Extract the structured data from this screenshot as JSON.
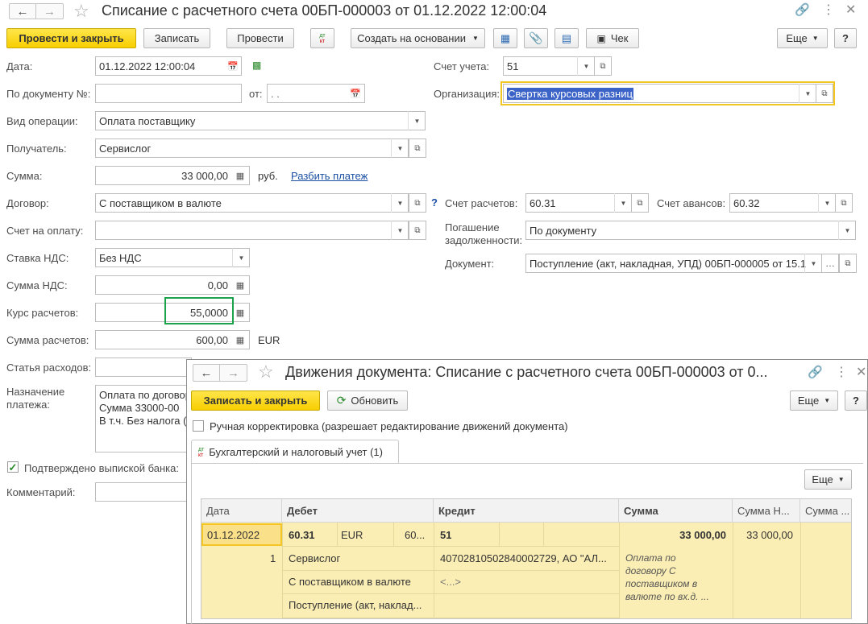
{
  "main": {
    "title": "Списание с расчетного счета 00БП-000003 от 01.12.2022 12:00:04",
    "toolbar": {
      "post_close": "Провести и закрыть",
      "save": "Записать",
      "post": "Провести",
      "create_based": "Создать на основании",
      "check": "Чек",
      "more": "Еще",
      "help": "?"
    },
    "form": {
      "date_label": "Дата:",
      "date_value": "01.12.2022 12:00:04",
      "doc_no_label": "По документу №:",
      "doc_no_value": "",
      "from_label": "от:",
      "from_value": " .  .",
      "op_type_label": "Вид операции:",
      "op_type_value": "Оплата поставщику",
      "recipient_label": "Получатель:",
      "recipient_value": "Сервислог",
      "sum_label": "Сумма:",
      "sum_value": "33 000,00",
      "currency_rub": "руб.",
      "split_payment": "Разбить платеж",
      "contract_label": "Договор:",
      "contract_value": "С поставщиком в валюте",
      "invoice_label": "Счет на оплату:",
      "invoice_value": "",
      "vat_rate_label": "Ставка НДС:",
      "vat_rate_value": "Без НДС",
      "vat_sum_label": "Сумма НДС:",
      "vat_sum_value": "0,00",
      "rate_label": "Курс расчетов:",
      "rate_value": "55,0000",
      "settle_sum_label": "Сумма расчетов:",
      "settle_sum_value": "600,00",
      "settle_currency": "EUR",
      "expense_label": "Статья расходов:",
      "purpose_label": "Назначение платежа:",
      "purpose_lines": [
        "Оплата по договор",
        "Сумма 33000-00",
        "В т.ч. Без налога ("
      ],
      "confirmed_label": "Подтверждено выпиской банка:",
      "comment_label": "Комментарий:",
      "account_label": "Счет учета:",
      "account_value": "51",
      "org_label": "Организация:",
      "org_value": "Свертка курсовых разниц",
      "settle_account_label": "Счет расчетов:",
      "settle_account_value": "60.31",
      "advance_account_label": "Счет авансов:",
      "advance_account_value": "60.32",
      "debt_label_1": "Погашение",
      "debt_label_2": "задолженности:",
      "debt_value": "По документу",
      "document_label": "Документ:",
      "document_value": "Поступление (акт, накладная, УПД) 00БП-000005 от 15.1",
      "question": "?"
    }
  },
  "movements": {
    "title": "Движения документа: Списание с расчетного счета 00БП-000003 от 0...",
    "save_close": "Записать и закрыть",
    "refresh": "Обновить",
    "more": "Еще",
    "help": "?",
    "manual_label": "Ручная корректировка (разрешает редактирование движений документа)",
    "tab_label": "Бухгалтерский и налоговый учет (1)",
    "grid_more": "Еще",
    "columns": [
      "Дата",
      "Дебет",
      "Кредит",
      "Сумма",
      "Сумма Н...",
      "Сумма ..."
    ],
    "row": {
      "date": "01.12.2022",
      "num": "1",
      "debit_account": "60.31",
      "debit_currency": "EUR",
      "debit_extra": "60...",
      "debit_sub1": "Сервислог",
      "debit_sub2": "С поставщиком в валюте",
      "debit_sub3": "Поступление (акт, наклад...",
      "credit_account": "51",
      "credit_sub1": "40702810502840002729, АО \"АЛ...",
      "credit_sub2": "<...>",
      "sum": "33 000,00",
      "sum_nu": "33 000,00",
      "content_lines": [
        "Оплата по",
        "договору С",
        "поставщиком в",
        "валюте по вх.д.  ..."
      ]
    }
  }
}
